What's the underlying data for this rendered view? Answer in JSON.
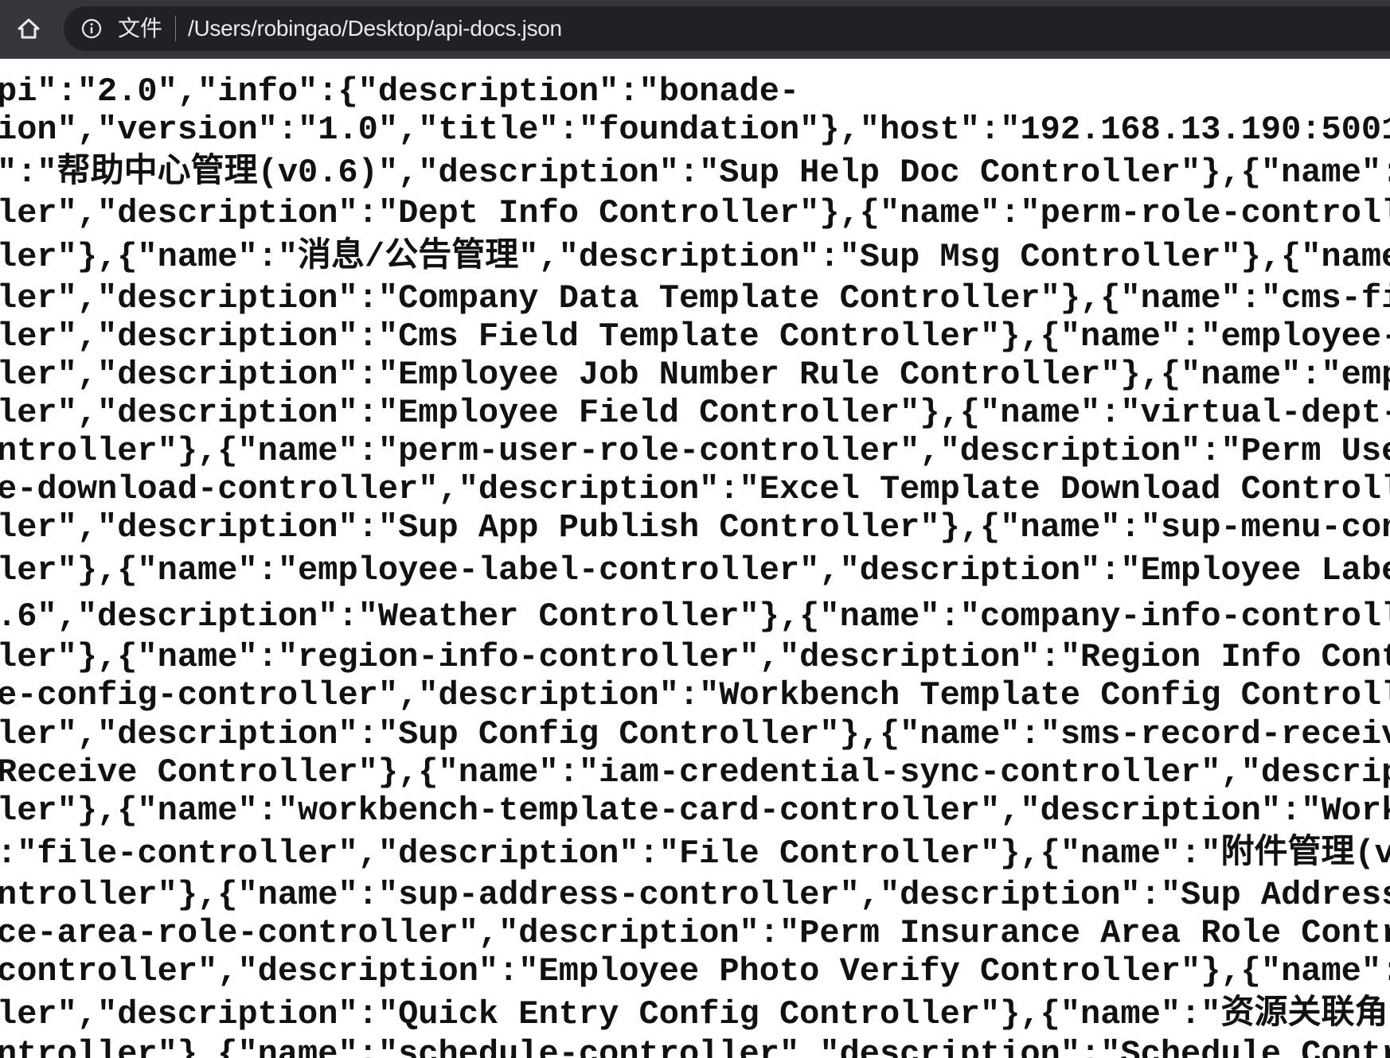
{
  "browser": {
    "scheme_label": "文件",
    "url": "/Users/robingao/Desktop/api-docs.json",
    "icons": [
      "home-icon",
      "info-icon"
    ]
  },
  "document": {
    "lines": [
      "pi\":\"2.0\",\"info\":{\"description\":\"bonade-",
      "ion\",\"version\":\"1.0\",\"title\":\"foundation\"},\"host\":\"192.168.13.190:5001",
      "\":\"帮助中心管理(v0.6)\",\"description\":\"Sup Help Doc Controller\"},{\"name\":",
      "ler\",\"description\":\"Dept Info Controller\"},{\"name\":\"perm-role-controll",
      "ler\"},{\"name\":\"消息/公告管理\",\"description\":\"Sup Msg Controller\"},{\"name",
      "ler\",\"description\":\"Company Data Template Controller\"},{\"name\":\"cms-fi",
      "ler\",\"description\":\"Cms Field Template Controller\"},{\"name\":\"employee-",
      "ler\",\"description\":\"Employee Job Number Rule Controller\"},{\"name\":\"emp",
      "ler\",\"description\":\"Employee Field Controller\"},{\"name\":\"virtual-dept-",
      "ntroller\"},{\"name\":\"perm-user-role-controller\",\"description\":\"Perm Use",
      "e-download-controller\",\"description\":\"Excel Template Download Controll",
      "ler\",\"description\":\"Sup App Publish Controller\"},{\"name\":\"sup-menu-con",
      "ler\"},{\"name\":\"employee-label-controller\",\"description\":\"Employee Labe",
      ".6\",\"description\":\"Weather Controller\"},{\"name\":\"company-info-controll",
      "ler\"},{\"name\":\"region-info-controller\",\"description\":\"Region Info Cont",
      "e-config-controller\",\"description\":\"Workbench Template Config Controll",
      "ler\",\"description\":\"Sup Config Controller\"},{\"name\":\"sms-record-receiv",
      "Receive Controller\"},{\"name\":\"iam-credential-sync-controller\",\"descrip",
      "ler\"},{\"name\":\"workbench-template-card-controller\",\"description\":\"Work",
      ":\"file-controller\",\"description\":\"File Controller\"},{\"name\":\"附件管理(v",
      "ntroller\"},{\"name\":\"sup-address-controller\",\"description\":\"Sup Address",
      "ce-area-role-controller\",\"description\":\"Perm Insurance Area Role Contr",
      "controller\",\"description\":\"Employee Photo Verify Controller\"},{\"name\":",
      "ler\",\"description\":\"Quick Entry Config Controller\"},{\"name\":\"资源关联角",
      "ntroller\"},{\"name\":\"schedule-controller\",\"description\":\"Schedule Contr"
    ]
  }
}
